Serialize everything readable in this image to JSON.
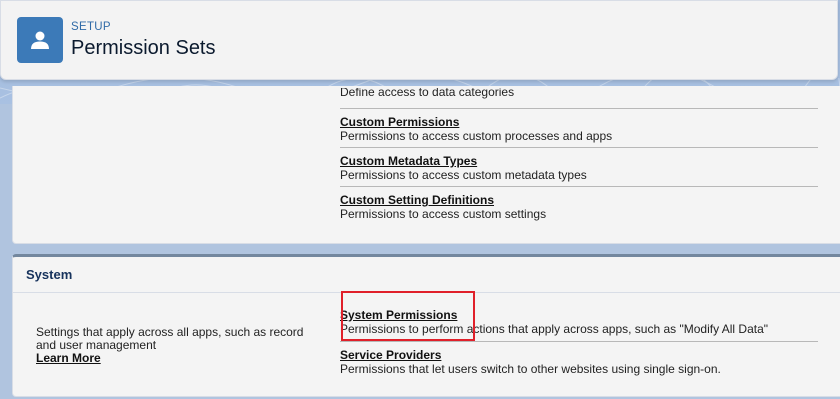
{
  "header": {
    "eyebrow": "SETUP",
    "title": "Permission Sets",
    "icon": "user-icon"
  },
  "card1": {
    "partial_desc": "Define access to data categories",
    "items": [
      {
        "label": "Custom Permissions",
        "desc": "Permissions to access custom processes and apps"
      },
      {
        "label": "Custom Metadata Types",
        "desc": "Permissions to access custom metadata types"
      },
      {
        "label": "Custom Setting Definitions",
        "desc": "Permissions to access custom settings"
      }
    ]
  },
  "system": {
    "title": "System",
    "description": "Settings that apply across all apps, such as record and user management",
    "learn_more": "Learn More",
    "items": [
      {
        "label": "System Permissions",
        "desc": "Permissions to perform actions that apply across apps, such as \"Modify All Data\""
      },
      {
        "label": "Service Providers",
        "desc": "Permissions that let users switch to other websites using single sign-on."
      }
    ]
  },
  "colors": {
    "brand_icon": "#3c7ab8",
    "highlight": "#e0202a",
    "section_border": "#73879e"
  }
}
